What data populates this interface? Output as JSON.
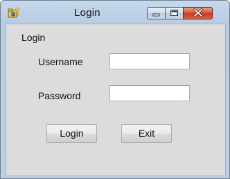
{
  "window": {
    "title": "Login",
    "icon": "folder-key-icon",
    "controls": {
      "minimize": "minimize-icon",
      "maximize": "maximize-icon",
      "close": "close-icon"
    }
  },
  "form": {
    "group_label": "Login",
    "username_label": "Username",
    "username_value": "",
    "password_label": "Password",
    "password_value": "",
    "login_button": "Login",
    "exit_button": "Exit"
  },
  "colors": {
    "close_button": "#c73a1c",
    "client_background": "#dcdcdc",
    "title_bar": "#bcd0e6"
  }
}
